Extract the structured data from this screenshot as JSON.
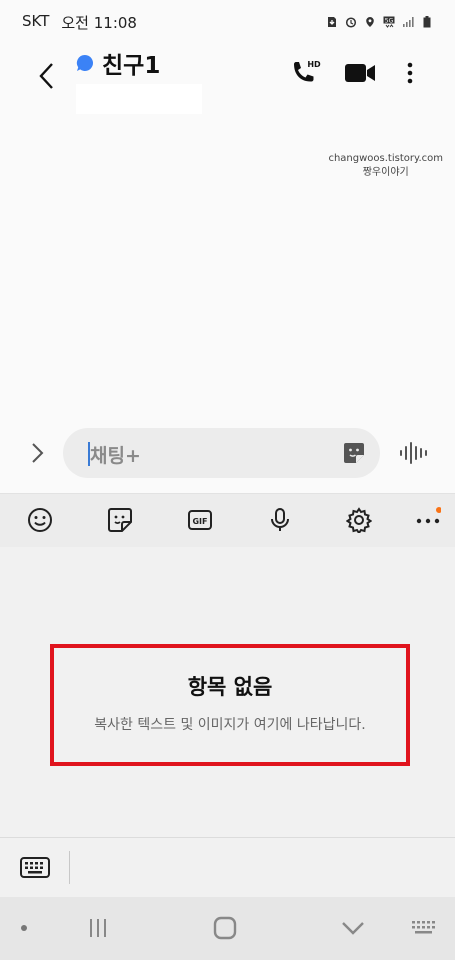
{
  "status_bar": {
    "carrier": "SKT",
    "time": "오전 11:08",
    "icons": [
      "sim-download-icon",
      "alarm-icon",
      "location-icon",
      "5g-icon",
      "signal-icon",
      "battery-icon"
    ]
  },
  "header": {
    "title": "친구1",
    "presence_color": "#3b82f6",
    "call_badge": "HD"
  },
  "watermark": {
    "line1": "changwoos.tistory.com",
    "line2": "짱우이야기"
  },
  "composer": {
    "placeholder": "채팅+",
    "caret_color": "#3a7bd5"
  },
  "toolbar": {
    "items": [
      "emoji-icon",
      "sticker-icon",
      "gif-icon",
      "mic-icon",
      "settings-icon",
      "more-icon"
    ],
    "gif_label": "GIF",
    "notification_dot_color": "#f97316"
  },
  "clipboard": {
    "empty_title": "항목 없음",
    "empty_description": "복사한 텍스트 및 이미지가 여기에 나타납니다.",
    "highlight_color": "#e0141e"
  },
  "navigation": {
    "items": [
      "dot",
      "recent-apps",
      "home",
      "back",
      "keyboard-switch"
    ]
  }
}
